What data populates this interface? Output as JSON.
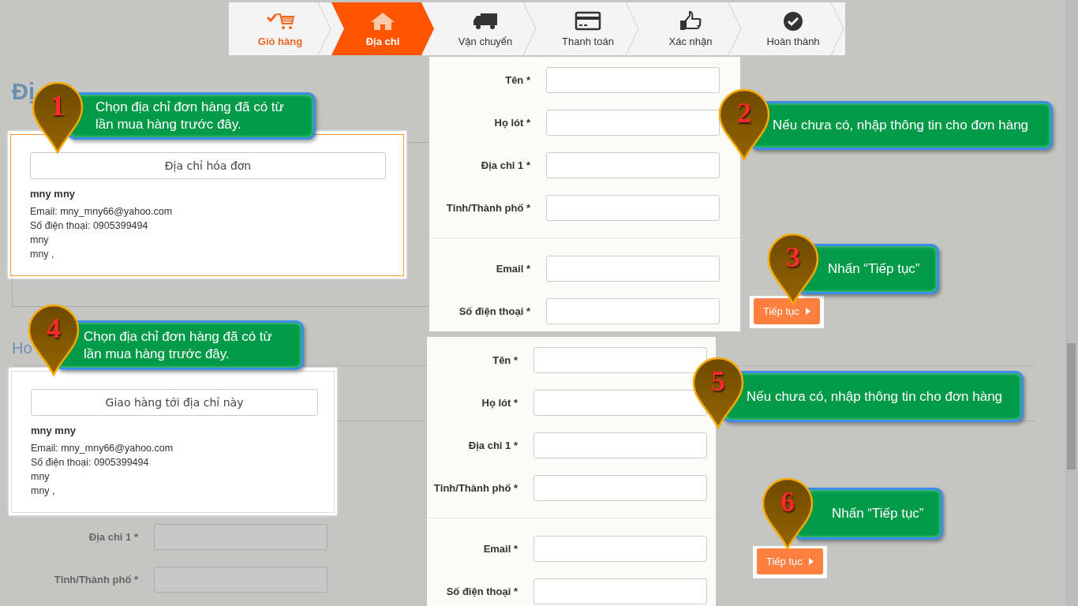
{
  "steps": [
    {
      "label": "Giỏ hàng",
      "done": true,
      "selected": false
    },
    {
      "label": "Địa chỉ",
      "done": false,
      "selected": true
    },
    {
      "label": "Vận chuyển",
      "done": false,
      "selected": false
    },
    {
      "label": "Thanh toán",
      "done": false,
      "selected": false
    },
    {
      "label": "Xác nhận",
      "done": false,
      "selected": false
    },
    {
      "label": "Hoàn thành",
      "done": false,
      "selected": false
    }
  ],
  "background": {
    "heading": "Đị",
    "subheading": "Ho",
    "fields": [
      {
        "label": "Địa chỉ 1 *"
      },
      {
        "label": "Tỉnh/Thành phố *"
      }
    ]
  },
  "forms": [
    {
      "fields": [
        {
          "label": "Tên *"
        },
        {
          "label": "Họ lót *"
        },
        {
          "label": "Địa chỉ 1 *"
        },
        {
          "label": "Tỉnh/Thành phố *"
        }
      ],
      "contact_fields": [
        {
          "label": "Email *"
        },
        {
          "label": "Số điện thoại *"
        }
      ]
    },
    {
      "fields": [
        {
          "label": "Tên *"
        },
        {
          "label": "Họ lót *"
        },
        {
          "label": "Địa chỉ 1 *"
        },
        {
          "label": "Tỉnh/Thành phố *"
        }
      ],
      "contact_fields": [
        {
          "label": "Email *"
        },
        {
          "label": "Số điện thoại *"
        }
      ]
    }
  ],
  "address_cards": [
    {
      "button": "Địa chỉ hóa đơn",
      "name": "mny mny",
      "lines": [
        "Email: mny_mny66@yahoo.com",
        "Số điện thoại: 0905399494",
        "mny",
        "mny ,"
      ],
      "selected": true
    },
    {
      "button": "Giao hàng tới địa chỉ này",
      "name": "mny mny",
      "lines": [
        "Email: mny_mny66@yahoo.com",
        "Số điện thoại: 0905399494",
        "mny",
        "mny ,"
      ],
      "selected": false
    }
  ],
  "continue_buttons": [
    "Tiếp tục",
    "Tiếp tục"
  ],
  "callouts": [
    {
      "number": "1",
      "text": "Chọn địa chỉ đơn hàng đã có từ lần mua hàng trước đây."
    },
    {
      "number": "2",
      "text": "Nếu chưa có, nhập thông tin cho đơn hàng"
    },
    {
      "number": "3",
      "text": "Nhấn “Tiếp tục”"
    },
    {
      "number": "4",
      "text": "Chọn địa chỉ đơn hàng đã có từ lần mua hàng trước đây."
    },
    {
      "number": "5",
      "text": "Nếu chưa có, nhập thông tin cho đơn hàng"
    },
    {
      "number": "6",
      "text": "Nhấn “Tiếp tục”"
    }
  ]
}
